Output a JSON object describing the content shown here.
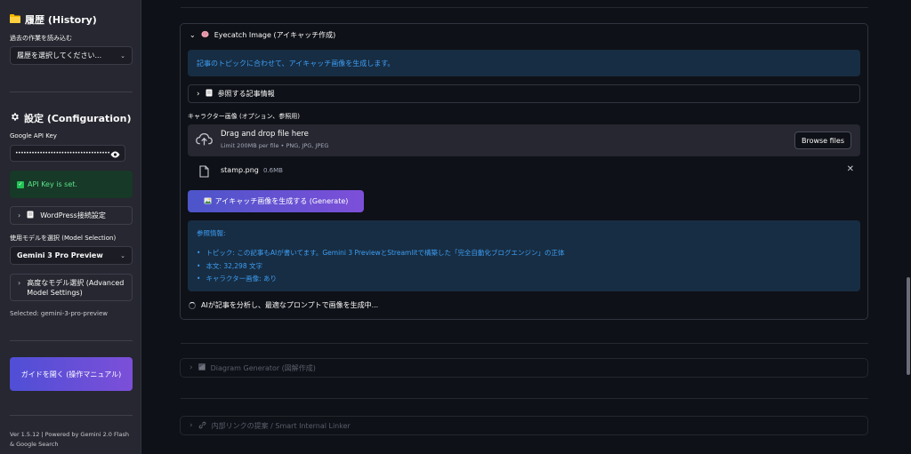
{
  "sidebar": {
    "history": {
      "heading": "履歴 (History)",
      "label": "過去の作業を読み込む",
      "select_value": "履歴を選択してください..."
    },
    "config": {
      "heading": "設定 (Configuration)",
      "api_key_label": "Google API Key",
      "api_key_value": "••••••••••••••••••••••••••••••••••••••",
      "api_key_status": "API Key is set.",
      "wordpress_expander": "WordPress接続設定",
      "model_label": "使用モデルを選択 (Model Selection)",
      "model_value": "Gemini 3 Pro Preview",
      "advanced_expander": "高度なモデル選択 (Advanced Model Settings)",
      "selected_text": "Selected: gemini-3-pro-preview"
    },
    "guide_button": "ガイドを開く (操作マニュアル)",
    "footer": "Ver 1.5.12 | Powered by Gemini 2.0 Flash & Google Search"
  },
  "main": {
    "eyecatch": {
      "header": "Eyecatch Image (アイキャッチ作成)",
      "info": "記事のトピックに合わせて、アイキャッチ画像を生成します。",
      "article_expander": "参照する記事情報",
      "uploader_label": "キャラクター画像 (オプション、参照用)",
      "dropzone_title": "Drag and drop file here",
      "dropzone_sub": "Limit 200MB per file • PNG, JPG, JPEG",
      "browse_button": "Browse files",
      "file_name": "stamp.png",
      "file_size": "0.6MB",
      "generate_button": "アイキャッチ画像を生成する (Generate)",
      "reference": {
        "title": "参照情報:",
        "items": [
          "トピック: この記事もAIが書いてます。Gemini 3 PreviewとStreamlitで構築した「完全自動化ブログエンジン」の正体",
          "本文: 32,298 文字",
          "キャラクター画像: あり"
        ]
      },
      "spinner_text": "AIが記事を分析し、最適なプロンプトで画像を生成中..."
    },
    "diagram_expander": "Diagram Generator (図解作成)",
    "internal_link_expander": "内部リンクの提案 / Smart Internal Linker"
  },
  "colors": {
    "background": "#0e1117",
    "sidebar": "#262730",
    "info_bg": "#172d43",
    "info_text": "#3d9df3",
    "success_bg": "#173928",
    "success_text": "#5ce488",
    "accent_gradient_start": "#4f4fd6",
    "accent_gradient_end": "#7c4fd8"
  },
  "icons": {
    "history": "folder-icon",
    "config": "gear-icon",
    "eyecatch": "brain-icon",
    "upload": "cloud-upload-icon",
    "file": "file-icon",
    "diagram": "chart-icon",
    "internal_link": "link-icon"
  }
}
